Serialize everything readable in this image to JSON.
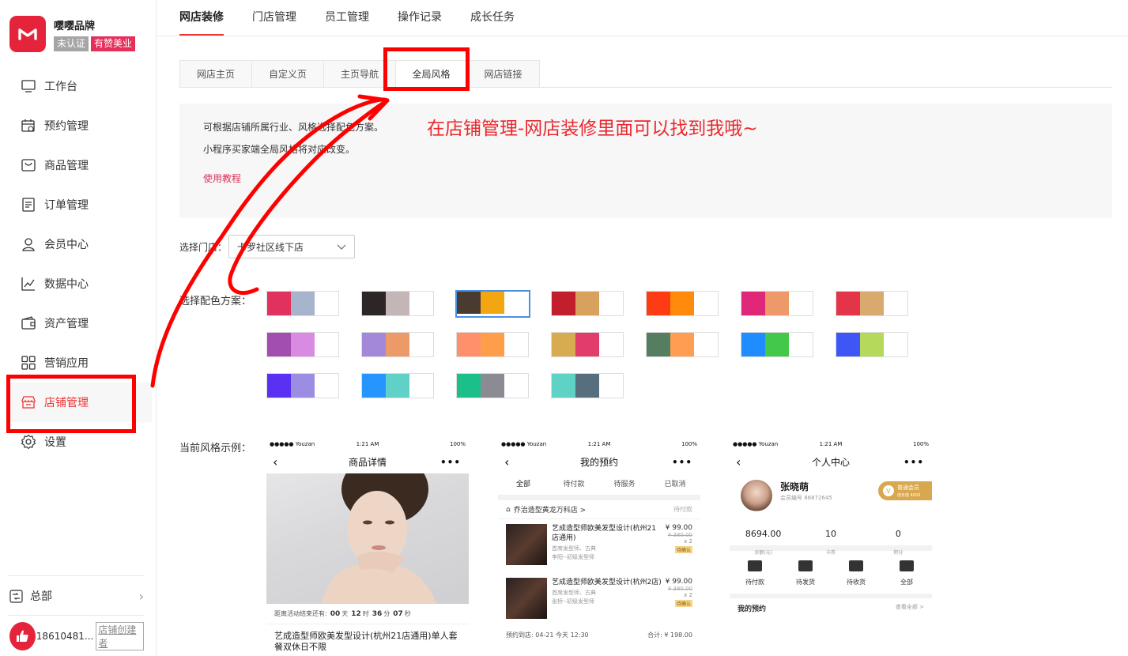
{
  "brand": {
    "name": "嘤嘤品牌",
    "badge_unverified": "未认证",
    "badge_partner": "有赞美业"
  },
  "sidebar": {
    "items": [
      {
        "label": "工作台",
        "icon": "monitor-icon"
      },
      {
        "label": "预约管理",
        "icon": "calendar-icon"
      },
      {
        "label": "商品管理",
        "icon": "goods-icon"
      },
      {
        "label": "订单管理",
        "icon": "order-list-icon"
      },
      {
        "label": "会员中心",
        "icon": "user-icon"
      },
      {
        "label": "数据中心",
        "icon": "chart-icon"
      },
      {
        "label": "资产管理",
        "icon": "wallet-icon"
      },
      {
        "label": "营销应用",
        "icon": "apps-grid-icon"
      },
      {
        "label": "店铺管理",
        "icon": "store-icon"
      },
      {
        "label": "设置",
        "icon": "gear-icon"
      }
    ],
    "active_index": 8,
    "hq_label": "总部",
    "user_id": "18610481...",
    "user_role": "店铺创建者"
  },
  "top_tabs": [
    "网店装修",
    "门店管理",
    "员工管理",
    "操作记录",
    "成长任务"
  ],
  "top_tab_active": 0,
  "sub_tabs": [
    "网店主页",
    "自定义页",
    "主页导航",
    "全局风格",
    "网店链接"
  ],
  "sub_tab_active": 3,
  "info": {
    "line1": "可根据店铺所属行业、风格选择配色方案。",
    "line2": "小程序买家端全局风格将对应改变。",
    "tutorial_link": "使用教程"
  },
  "annotation_text": "在店铺管理-网店装修里面可以找到我哦~",
  "store_select": {
    "label": "选择门店：",
    "value": "卡罗社区线下店"
  },
  "color_scheme_label": "选择配色方案：",
  "color_schemes": [
    [
      "#e0325d",
      "#a7b4cc"
    ],
    [
      "#2d2626",
      "#c4b6b6"
    ],
    [
      "#4a3b30",
      "#f2a712"
    ],
    [
      "#c21e2c",
      "#d8a25e"
    ],
    [
      "#fe3c14",
      "#ff8a0c"
    ],
    [
      "#e02778",
      "#ed9969"
    ],
    [
      "#e3344a",
      "#d9aa70"
    ],
    [
      "#a24db0",
      "#d98be1"
    ],
    [
      "#a388da",
      "#ec9a68"
    ],
    [
      "#ff906c",
      "#ff9e4a"
    ],
    [
      "#d7ab4f",
      "#e13c6a"
    ],
    [
      "#557d5f",
      "#ff9e52"
    ],
    [
      "#1f8cff",
      "#43c84a"
    ],
    [
      "#3d56f5",
      "#b4d95b"
    ],
    [
      "#5a30f3",
      "#9b8de2"
    ],
    [
      "#2795ff",
      "#5fd1c7"
    ],
    [
      "#1cbf8a",
      "#8b8b93"
    ],
    [
      "#5fd2c6",
      "#576e7e"
    ]
  ],
  "selected_scheme": 2,
  "example_label": "当前风格示例：",
  "phones": {
    "status": {
      "carrier": "●●●●● Youzan",
      "time": "1:21 AM",
      "battery": "100%"
    },
    "product": {
      "title": "商品详情",
      "countdown_label": "距离活动结束还有:",
      "countdown": [
        "00",
        "天",
        "12",
        "时",
        "36",
        "分",
        "07",
        "秒"
      ],
      "name": "艺成造型师欧美发型设计(杭州21店通用)单人套餐双休日不限"
    },
    "booking": {
      "title": "我的预约",
      "tabs": [
        "全部",
        "待付款",
        "待服务",
        "已取消"
      ],
      "shop": "乔治造型黄龙万科店 >",
      "shop_status": "待付款",
      "orders": [
        {
          "title": "艺成造型师欧美发型设计(杭州21店通用)",
          "sub1": "首席发型师、古典",
          "sub2": "李阳--初级发型师",
          "price": "¥ 99.00",
          "orig": "¥ 380.00",
          "qty": "x 2",
          "tag": "待确认"
        },
        {
          "title": "艺成造型师欧美发型设计(杭州2店)",
          "sub1": "首席发型师、古典",
          "sub2": "张桥--初级发型师",
          "price": "¥ 99.00",
          "orig": "¥ 380.00",
          "qty": "x 2",
          "tag": "待确认"
        }
      ],
      "foot_date": "预约到店: 04-21 今天 12:30",
      "foot_sum": "合计: ¥ 198.00"
    },
    "profile": {
      "title": "个人中心",
      "name": "张晓萌",
      "member_no": "会员编号 86872645",
      "vip": "普通会员",
      "vip_sub": "成长值 4000",
      "stats": [
        {
          "n": "8694.00",
          "u": "余额(元)"
        },
        {
          "n": "10",
          "u": "卡券"
        },
        {
          "n": "0",
          "u": "积分"
        }
      ],
      "icons": [
        "待付款",
        "待发货",
        "待收货",
        "全部"
      ],
      "my_appt": "我的预约",
      "view_all": "查看全部 >"
    }
  }
}
